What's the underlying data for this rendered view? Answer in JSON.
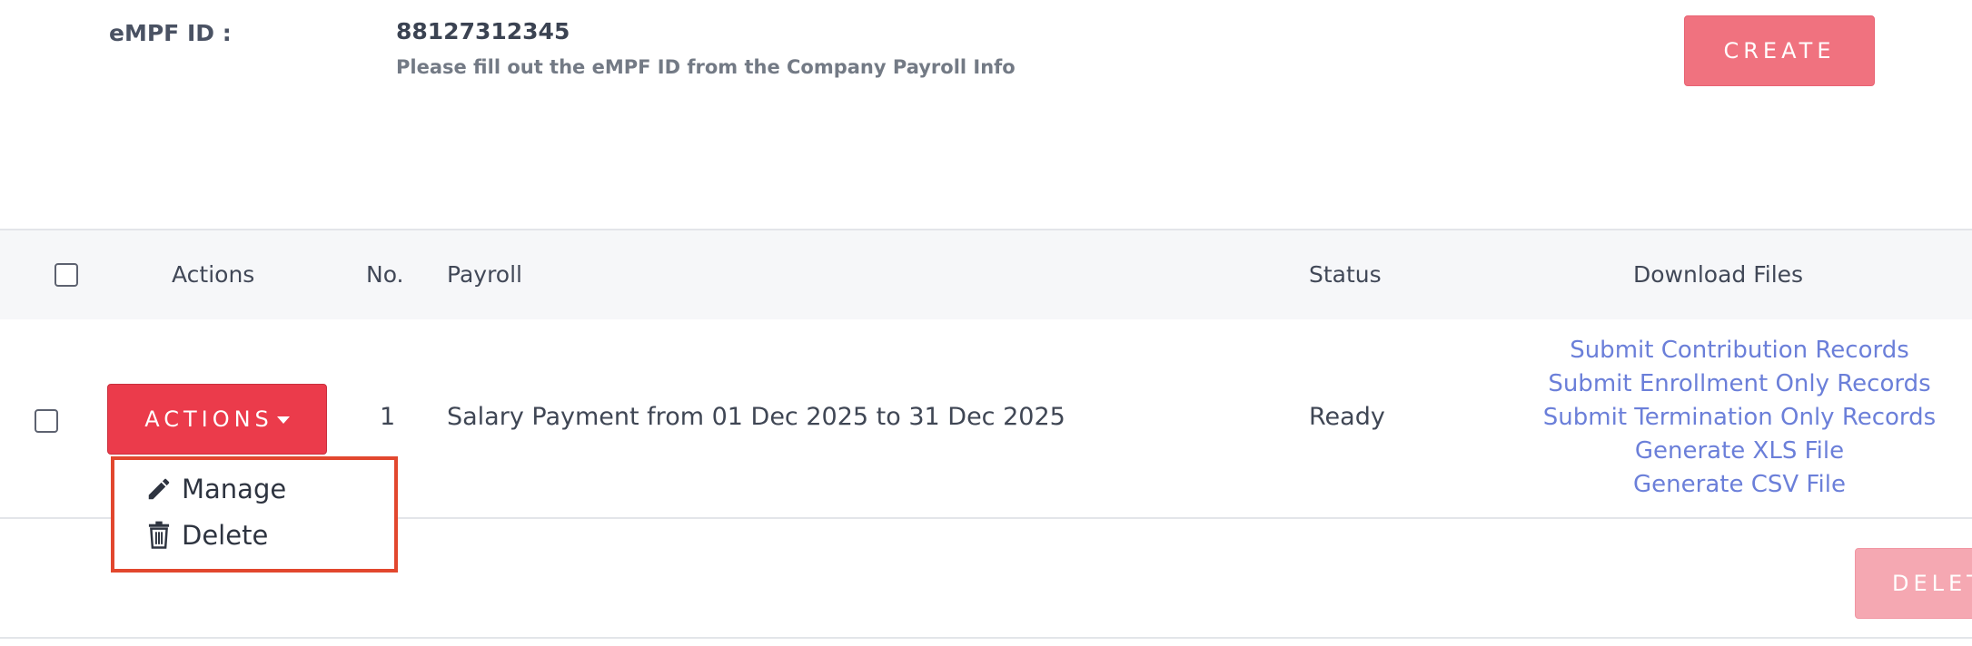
{
  "form": {
    "empf_label": "eMPF ID :",
    "empf_value": "88127312345",
    "empf_hint": "Please fill out the eMPF ID from the Company Payroll Info",
    "create_label": "CREATE"
  },
  "table": {
    "headers": {
      "actions": "Actions",
      "no": "No.",
      "payroll": "Payroll",
      "status": "Status",
      "download_files": "Download Files"
    },
    "rows": [
      {
        "actions_label": "ACTIONS",
        "no": "1",
        "payroll": "Salary Payment from 01 Dec 2025 to 31 Dec 2025",
        "status": "Ready",
        "downloads": [
          "Submit Contribution Records",
          "Submit Enrollment Only Records",
          "Submit Termination Only Records",
          "Generate XLS File",
          "Generate CSV File"
        ]
      }
    ]
  },
  "dropdown": {
    "manage": "Manage",
    "delete": "Delete",
    "highlight_color": "#e2472e"
  },
  "footer": {
    "delete_label": "DELETE"
  },
  "colors": {
    "primary_red": "#eb3b4b",
    "create_pink": "#f0727f",
    "link_blue": "#6b7fd9"
  }
}
